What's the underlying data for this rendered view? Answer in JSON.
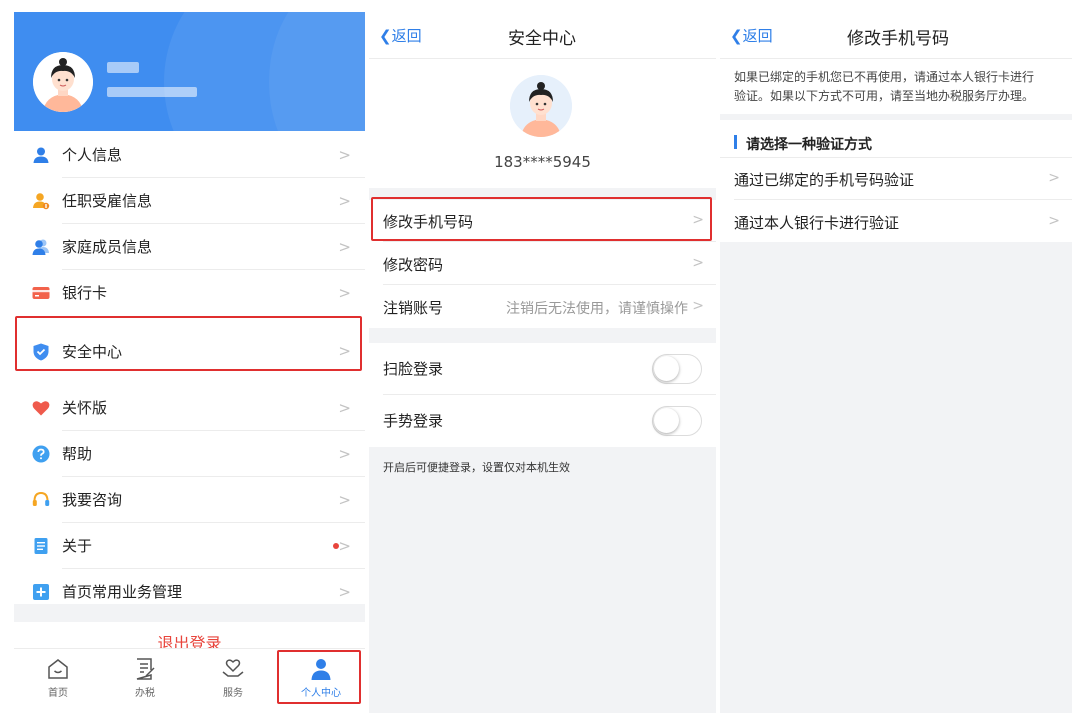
{
  "colors": {
    "accent": "#2f7fe8",
    "header_blue": "#3f8df0",
    "highlight_red": "#e02f2f",
    "logout_red": "#e8453c",
    "chevron_grey": "#c3c3c3",
    "page_grey": "#f2f3f5"
  },
  "panel1": {
    "menu": [
      {
        "label": "个人信息",
        "icon": "person-icon"
      },
      {
        "label": "任职受雇信息",
        "icon": "employment-icon"
      },
      {
        "label": "家庭成员信息",
        "icon": "family-icon"
      },
      {
        "label": "银行卡",
        "icon": "bank-card-icon"
      },
      {
        "label": "安全中心",
        "icon": "shield-icon"
      },
      {
        "label": "关怀版",
        "icon": "heart-icon"
      },
      {
        "label": "帮助",
        "icon": "help-icon"
      },
      {
        "label": "我要咨询",
        "icon": "headset-icon"
      },
      {
        "label": "关于",
        "icon": "document-icon"
      },
      {
        "label": "首页常用业务管理",
        "icon": "add-icon"
      }
    ],
    "chevron": ">",
    "logout": "退出登录",
    "tabs": [
      {
        "label": "首页",
        "icon": "home-icon"
      },
      {
        "label": "办税",
        "icon": "tax-form-icon"
      },
      {
        "label": "服务",
        "icon": "service-heart-icon"
      },
      {
        "label": "个人中心",
        "icon": "user-center-icon"
      }
    ]
  },
  "panel2": {
    "back": "返回",
    "title": "安全中心",
    "phone": "183****5945",
    "rows": [
      {
        "label": "修改手机号码",
        "hint": ""
      },
      {
        "label": "修改密码",
        "hint": ""
      },
      {
        "label": "注销账号",
        "hint": "注销后无法使用，请谨慎操作"
      }
    ],
    "toggles": [
      {
        "label": "扫脸登录",
        "on": false
      },
      {
        "label": "手势登录",
        "on": false
      }
    ],
    "note": "开启后可便捷登录，设置仅对本机生效"
  },
  "panel3": {
    "back": "返回",
    "title": "修改手机号码",
    "intro_line1": "如果已绑定的手机您已不再使用，请通过本人银行卡进行",
    "intro_line2": "验证。如果以下方式不可用，请至当地办税服务厅办理。",
    "section_title": "请选择一种验证方式",
    "options": [
      {
        "label": "通过已绑定的手机号码验证"
      },
      {
        "label": "通过本人银行卡进行验证"
      }
    ]
  }
}
